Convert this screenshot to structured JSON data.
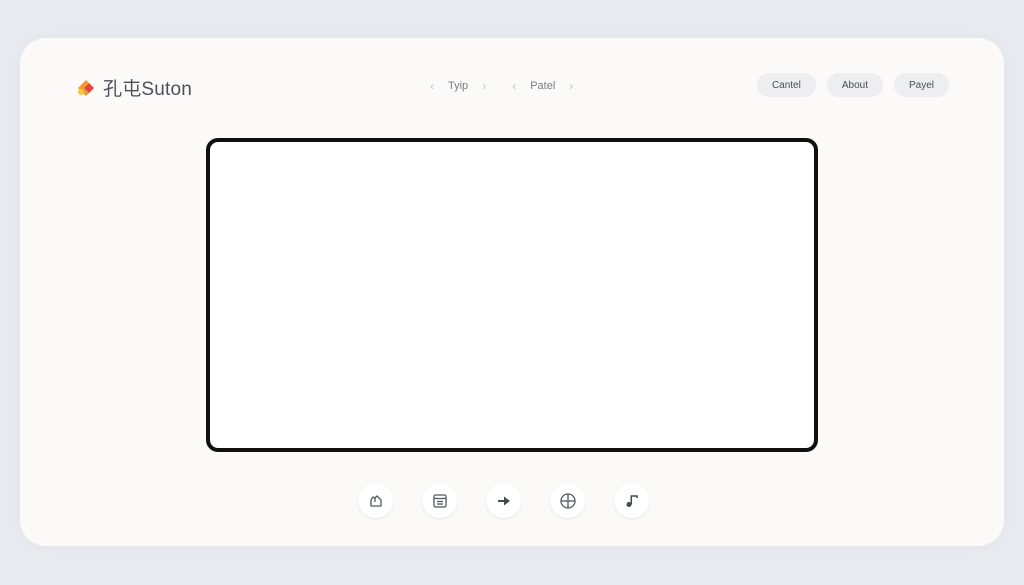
{
  "header": {
    "brand_name": "孔屯Suton",
    "breadcrumbs": [
      {
        "label": "Tyip"
      },
      {
        "label": "Patel"
      }
    ],
    "actions": [
      {
        "label": "Cantel"
      },
      {
        "label": "About"
      },
      {
        "label": "Payel"
      }
    ]
  },
  "toolbar": {
    "tools": [
      {
        "icon": "hand-icon"
      },
      {
        "icon": "calendar-icon"
      },
      {
        "icon": "arrow-right-icon"
      },
      {
        "icon": "globe-icon"
      },
      {
        "icon": "music-note-icon"
      }
    ]
  },
  "colors": {
    "background": "#e8ebef",
    "window": "#fbfaf8",
    "canvas_border": "#101010",
    "logo_orange": "#f29a2e",
    "logo_red": "#e5433b",
    "logo_yellow": "#f6c744"
  }
}
